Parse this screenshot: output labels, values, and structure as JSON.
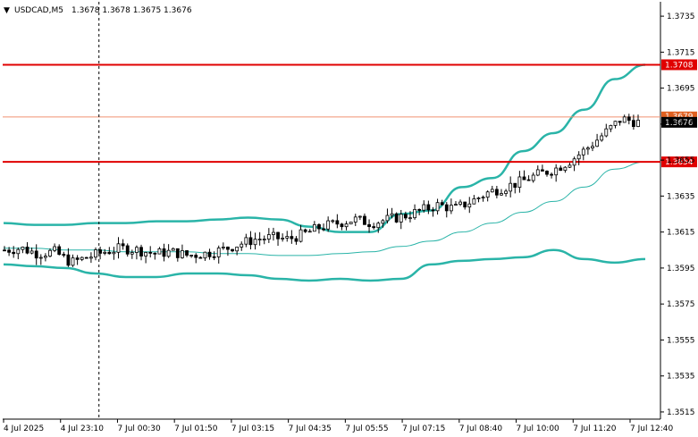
{
  "window": {
    "title": "USDCAD,M5",
    "ohlc": "1.3678 1.3678 1.3675 1.3676"
  },
  "colors": {
    "background": "#ffffff",
    "candle": "#000000",
    "band": "#2ab4a8",
    "support_resistance": "#e00000",
    "current_price_line": "#f09070",
    "current_price_bg": "#000000",
    "level_bg": "#e00000"
  },
  "chart_data": {
    "type": "candlestick",
    "symbol": "USDCAD",
    "timeframe": "M5",
    "y_ticks": [
      "1.3735",
      "1.3715",
      "1.3695",
      "1.3675",
      "1.3655",
      "1.3635",
      "1.3615",
      "1.3595",
      "1.3575",
      "1.3555",
      "1.3535",
      "1.3515"
    ],
    "x_ticks": [
      "4 Jul 2025",
      "4 Jul 23:10",
      "7 Jul 00:30",
      "7 Jul 01:50",
      "7 Jul 03:15",
      "7 Jul 04:35",
      "7 Jul 05:55",
      "7 Jul 07:15",
      "7 Jul 08:40",
      "7 Jul 10:00",
      "7 Jul 11:20",
      "7 Jul 12:40"
    ],
    "ylim": [
      1.3511,
      1.3743
    ],
    "horizontal_levels": [
      {
        "label": "1.3708",
        "value": 1.3708
      },
      {
        "label": "1.3654",
        "value": 1.3654
      }
    ],
    "current_price": {
      "label": "1.3676",
      "value": 1.3676
    },
    "ask_price": {
      "label": "1.3679",
      "value": 1.3679
    },
    "bands": {
      "n_points": 140,
      "upper": [
        1.362,
        1.3619,
        1.3619,
        1.362,
        1.362,
        1.3621,
        1.3621,
        1.3622,
        1.3623,
        1.3622,
        1.3618,
        1.3615,
        1.3615,
        1.3625,
        1.3627,
        1.364,
        1.3645,
        1.366,
        1.367,
        1.3683,
        1.37,
        1.3708
      ],
      "middle": [
        1.3606,
        1.3606,
        1.3605,
        1.3605,
        1.3604,
        1.3604,
        1.3604,
        1.3603,
        1.3603,
        1.3602,
        1.3602,
        1.3603,
        1.3604,
        1.3607,
        1.361,
        1.3615,
        1.362,
        1.3626,
        1.3632,
        1.364,
        1.365,
        1.3654
      ],
      "lower": [
        1.3597,
        1.3596,
        1.3595,
        1.3592,
        1.359,
        1.359,
        1.3592,
        1.3592,
        1.3591,
        1.3589,
        1.3588,
        1.3589,
        1.3588,
        1.3589,
        1.3597,
        1.3599,
        1.36,
        1.3601,
        1.3605,
        1.36,
        1.3598,
        1.36
      ]
    },
    "candles": {
      "n_points": 140,
      "mid_path": [
        1.3605,
        1.3606,
        1.3603,
        1.3604,
        1.3598,
        1.3601,
        1.3604,
        1.3606,
        1.3605,
        1.3603,
        1.3604,
        1.3602,
        1.3603,
        1.3605,
        1.3608,
        1.3611,
        1.3612,
        1.3611,
        1.3614,
        1.3618,
        1.362,
        1.3622,
        1.362,
        1.3622,
        1.3624,
        1.3627,
        1.363,
        1.3628,
        1.3632,
        1.3637,
        1.364,
        1.3643,
        1.3647,
        1.365,
        1.3655,
        1.3662,
        1.367,
        1.3678,
        1.3676
      ]
    },
    "crosshair_x_label": "4 Jul 23:10"
  }
}
